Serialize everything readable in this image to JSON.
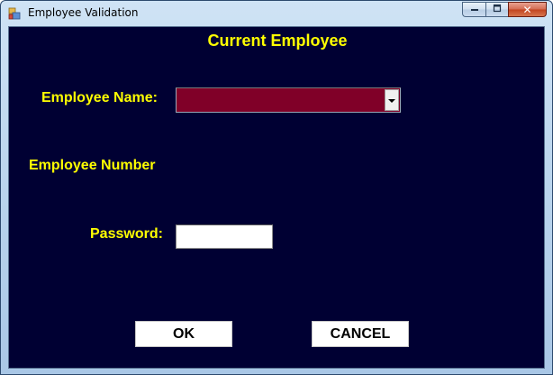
{
  "window": {
    "title": "Employee Validation",
    "icon": "app-window-icon",
    "controls": {
      "minimize_icon": "minimize-icon",
      "maximize_icon": "maximize-icon",
      "close_icon": "close-icon",
      "close_glyph": "✕"
    }
  },
  "form": {
    "heading": "Current Employee",
    "employee_name_label": "Employee Name:",
    "employee_name_value": "",
    "employee_number_label": "Employee Number",
    "password_label": "Password:",
    "password_value": "",
    "ok_label": "OK",
    "cancel_label": "CANCEL"
  },
  "colors": {
    "form_background": "#000033",
    "label_text": "#ffff00",
    "combo_background": "#800028",
    "button_background": "#ffffff"
  }
}
